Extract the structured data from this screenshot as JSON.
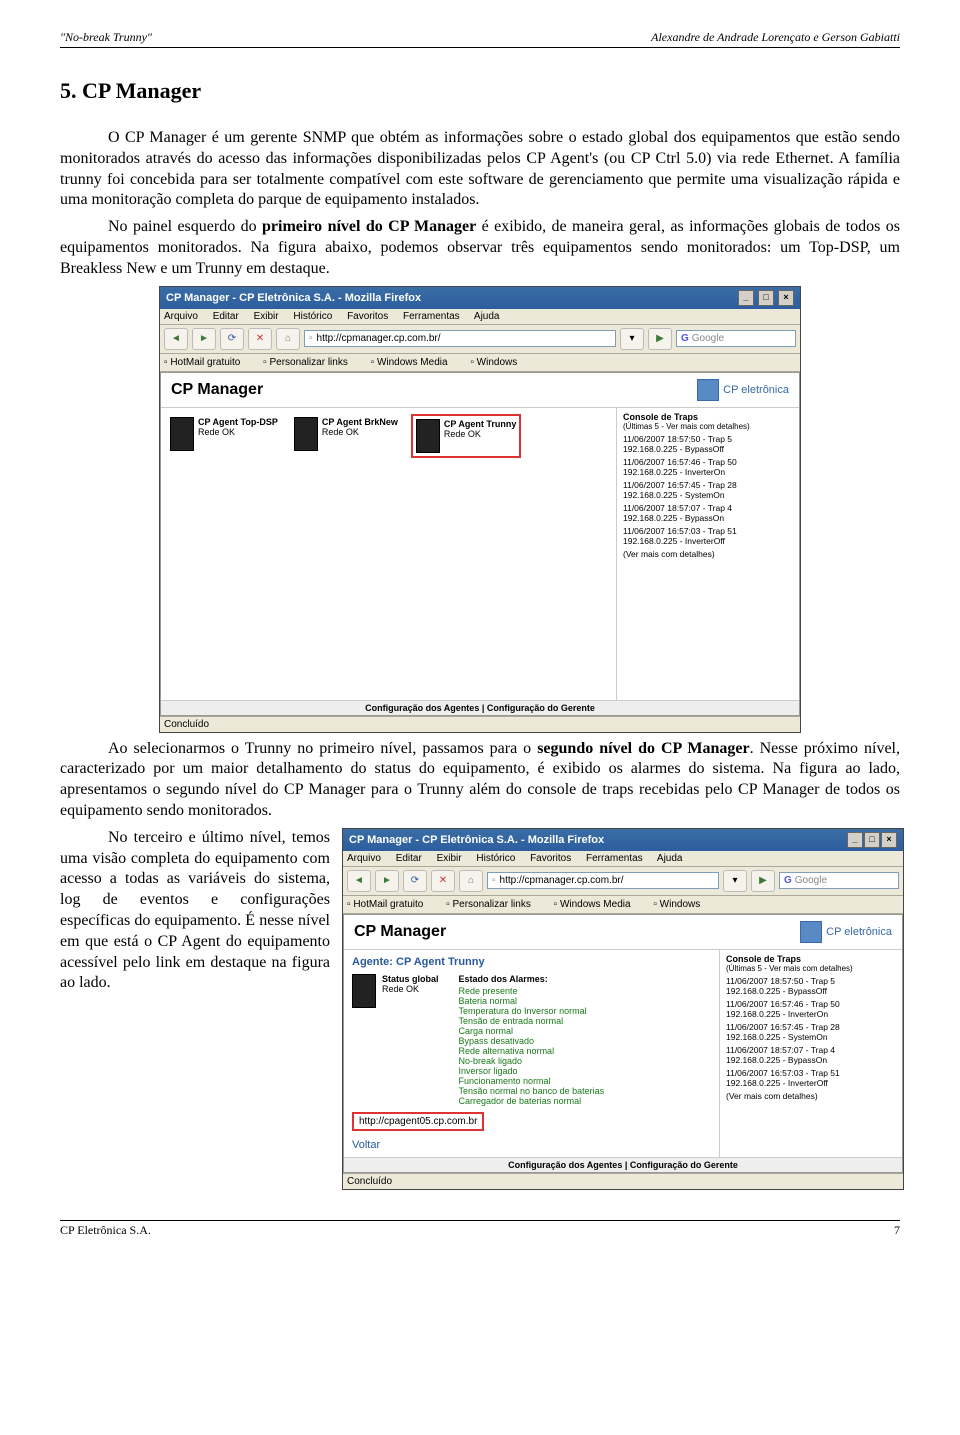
{
  "header": {
    "left": "\"No-break Trunny\"",
    "right": "Alexandre de Andrade Lorençato e Gerson Gabiatti"
  },
  "h": "5. CP Manager",
  "p1": "O CP Manager é um gerente SNMP que obtém as informações sobre o estado global dos equipamentos que estão sendo monitorados através do acesso das informações disponibilizadas pelos CP Agent's (ou CP Ctrl 5.0) via rede Ethernet. A família trunny foi concebida para ser totalmente compatível com este software de gerenciamento que permite uma visualização rápida e uma monitoração completa do parque de equipamento instalados.",
  "p2a": "No painel esquerdo do ",
  "p2b": "primeiro nível do CP Manager",
  "p2c": " é exibido, de maneira geral, as informações globais de todos os equipamentos monitorados. Na figura abaixo, podemos observar três equipamentos sendo monitorados: um Top-DSP, um Breakless New e um Trunny em destaque.",
  "p3a": "Ao selecionarmos o Trunny no primeiro nível, passamos para o ",
  "p3b": "segundo nível do CP Manager",
  "p3c": ". Nesse próximo nível, caracterizado por um maior detalhamento do status do equipamento, é exibido os alarmes do sistema. Na figura ao lado, apresentamos o segundo nível do CP Manager para o Trunny além do console de traps recebidas pelo CP Manager de todos os equipamento sendo monitorados.",
  "p4": "No terceiro e último nível, temos uma visão completa do equipamento com acesso a todas as variáveis do sistema, log de eventos e configurações específicas do equipamento. É nesse nível em que está o CP Agent do equipamento acessível pelo link em destaque na figura ao lado.",
  "app": {
    "title": "CP Manager - CP Eletrônica S.A. - Mozilla Firefox",
    "menu": [
      "Arquivo",
      "Editar",
      "Exibir",
      "Histórico",
      "Favoritos",
      "Ferramentas",
      "Ajuda"
    ],
    "url": "http://cpmanager.cp.com.br/",
    "search_ph": "Google",
    "bookmarks": [
      "HotMail gratuito",
      "Personalizar links",
      "Windows Media",
      "Windows"
    ],
    "logo": "CP Manager",
    "brand": "CP eletrônica",
    "agents": [
      {
        "name": "CP Agent Top-DSP",
        "status": "Rede OK"
      },
      {
        "name": "CP Agent BrkNew",
        "status": "Rede OK"
      },
      {
        "name": "CP Agent Trunny",
        "status": "Rede OK"
      }
    ],
    "traps_title": "Console de Traps",
    "traps_sub": "(Últimas 5 - Ver mais com detalhes)",
    "traps": [
      {
        "t": "11/06/2007 18:57:50 - Trap 5",
        "d": "192.168.0.225 - BypassOff"
      },
      {
        "t": "11/06/2007 16:57:46 - Trap 50",
        "d": "192.168.0.225 - InverterOn"
      },
      {
        "t": "11/06/2007 16:57:45 - Trap 28",
        "d": "192.168.0.225 - SystemOn"
      },
      {
        "t": "11/06/2007 18:57:07 - Trap 4",
        "d": "192.168.0.225 - BypassOn"
      },
      {
        "t": "11/06/2007 16:57:03 - Trap 51",
        "d": "192.168.0.225 - InverterOff"
      }
    ],
    "traps_more": "(Ver mais com detalhes)",
    "cfgbar": "Configuração dos Agentes | Configuração do Gerente",
    "status": "Concluído"
  },
  "app2": {
    "agent_hd": "Agente: CP Agent Trunny",
    "sg": "Status global",
    "sgv": "Rede OK",
    "ea": "Estado dos Alarmes:",
    "alarms": [
      "Rede presente",
      "Bateria normal",
      "Temperatura do Inversor normal",
      "Tensão de entrada normal",
      "Carga normal",
      "Bypass desativado",
      "Rede alternativa normal",
      "No-break ligado",
      "Inversor ligado",
      "Funcionamento normal",
      "Tensão normal no banco de baterias",
      "Carregador de baterias normal"
    ],
    "link": "http://cpagent05.cp.com.br",
    "voltar": "Voltar"
  },
  "footer": {
    "l": "CP Eletrônica S.A.",
    "r": "7"
  }
}
